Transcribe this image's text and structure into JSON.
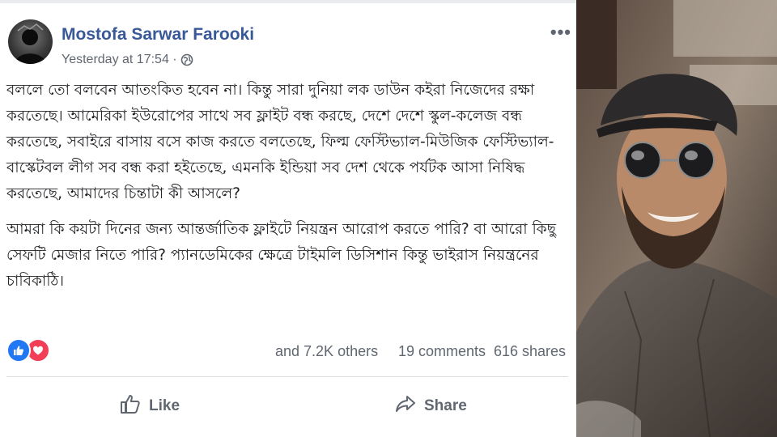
{
  "post": {
    "author": "Mostofa Sarwar Farooki",
    "timestamp": "Yesterday at 17:54 ·",
    "privacy_icon": "globe-icon",
    "menu_icon": "more-options-icon",
    "paragraphs": [
      "বললে তো বলবেন আতংকিত হবেন না। কিন্তু সারা দুনিয়া লক ডাউন কইরা নিজেদের রক্ষা করতেছে। আমেরিকা ইউরোপের সাথে সব ফ্লাইট বন্ধ করছে, দেশে দেশে স্কুল-কলেজ বন্ধ করতেছে, সবাইরে বাসায় বসে কাজ করতে বলতেছে, ফিল্ম ফেস্টিভ্যাল-মিউজিক ফেস্টিভ্যাল-বাস্কেটবল লীগ সব বন্ধ করা হইতেছে, এমনকি ইন্ডিয়া সব দেশ থেকে পর্যটক আসা নিষিদ্ধ করতেছে, আমাদের চিন্তাটা কী আসলে?",
      "আমরা কি কয়টা দিনের জন্য আন্তর্জাতিক ফ্লাইটে নিয়ন্ত্রন আরোপ করতে পারি? বা আরো কিছু সেফটি মেজার নিতে পারি? প্যানডেমিকের ক্ষেত্রে টাইমলি ডিসিশান কিন্তু ভাইরাস নিয়ন্ত্রনের চাবিকাঠি।"
    ]
  },
  "engagement": {
    "reactions": [
      "like-reaction-icon",
      "love-reaction-icon"
    ],
    "others_text": "and 7.2K others",
    "comments_text": "19 comments",
    "shares_text": "616 shares"
  },
  "actions": {
    "like_label": "Like",
    "share_label": "Share"
  },
  "colors": {
    "author_link": "#385898",
    "like_reaction": "#2078f4",
    "love_reaction": "#f33e58",
    "muted_text": "#606770"
  }
}
